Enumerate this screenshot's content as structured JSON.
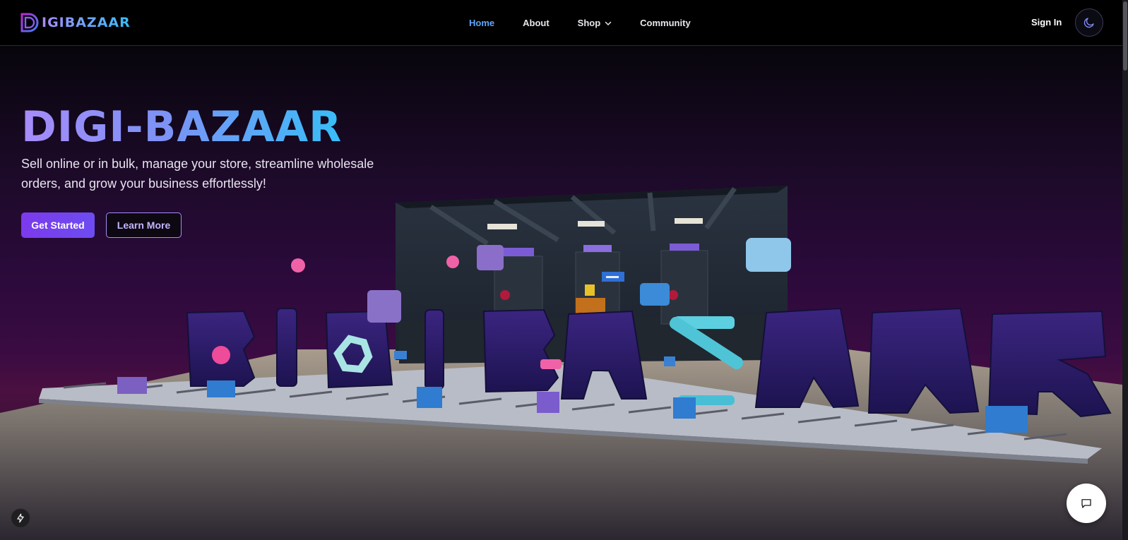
{
  "brand": {
    "name": "IGIBAZAAR",
    "logo_icon": "d-logo-icon"
  },
  "nav": {
    "items": [
      {
        "label": "Home",
        "active": true
      },
      {
        "label": "About",
        "active": false
      },
      {
        "label": "Shop",
        "active": false,
        "has_dropdown": true
      },
      {
        "label": "Community",
        "active": false
      }
    ],
    "signin_label": "Sign In",
    "theme_icon": "moon-icon"
  },
  "hero": {
    "title": "DIGI-BAZAAR",
    "subtitle": "Sell online or in bulk, manage your store, streamline wholesale orders, and grow your business effortlessly!",
    "primary_cta": "Get Started",
    "secondary_cta": "Learn More"
  },
  "floating": {
    "chat_icon": "chat-bubble-icon",
    "bolt_icon": "lightning-bolt-icon"
  },
  "colors": {
    "accent": "#7c3aed",
    "link_active": "#60a5fa",
    "title_gradient_start": "#a78bfa",
    "title_gradient_end": "#38bdf8"
  }
}
